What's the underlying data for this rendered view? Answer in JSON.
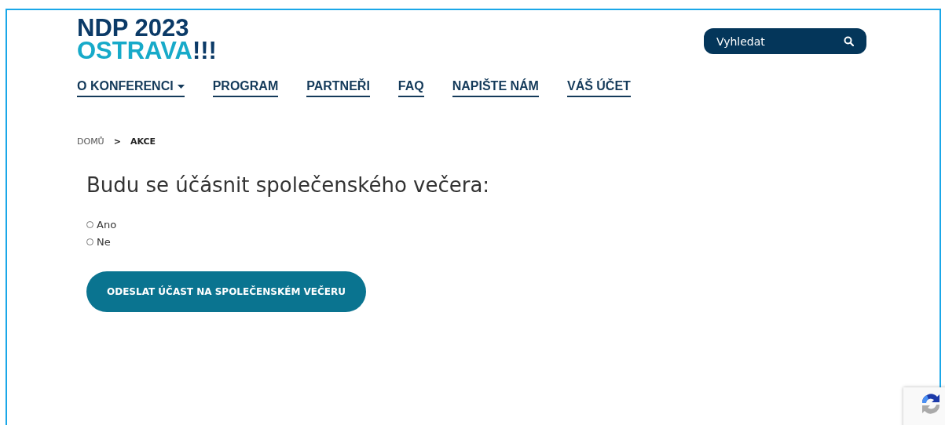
{
  "logo": {
    "line_1": "NDP 2023",
    "line_2": "OSTRAVA",
    "line_2_suffix": "!!!"
  },
  "search": {
    "placeholder": "Vyhledat"
  },
  "nav": [
    {
      "label": "O KONFERENCI",
      "dropdown": true
    },
    {
      "label": "PROGRAM",
      "dropdown": false
    },
    {
      "label": "PARTNEŘI",
      "dropdown": false
    },
    {
      "label": "FAQ",
      "dropdown": false
    },
    {
      "label": "NAPIŠTE NÁM",
      "dropdown": false
    },
    {
      "label": "VÁŠ ÚČET",
      "dropdown": false
    }
  ],
  "breadcrumb": [
    {
      "label": "DOMŮ",
      "current": false
    },
    {
      "label": "AKCE",
      "current": true
    }
  ],
  "breadcrumb_separator": ">",
  "form": {
    "question": "Budu se účásnit společenského večera:",
    "options": [
      {
        "label": "Ano",
        "selected": false
      },
      {
        "label": "Ne",
        "selected": false
      }
    ],
    "submit": "ODESLAT ÚČAST NA SPOLEČENSKÉM VEČERU"
  }
}
